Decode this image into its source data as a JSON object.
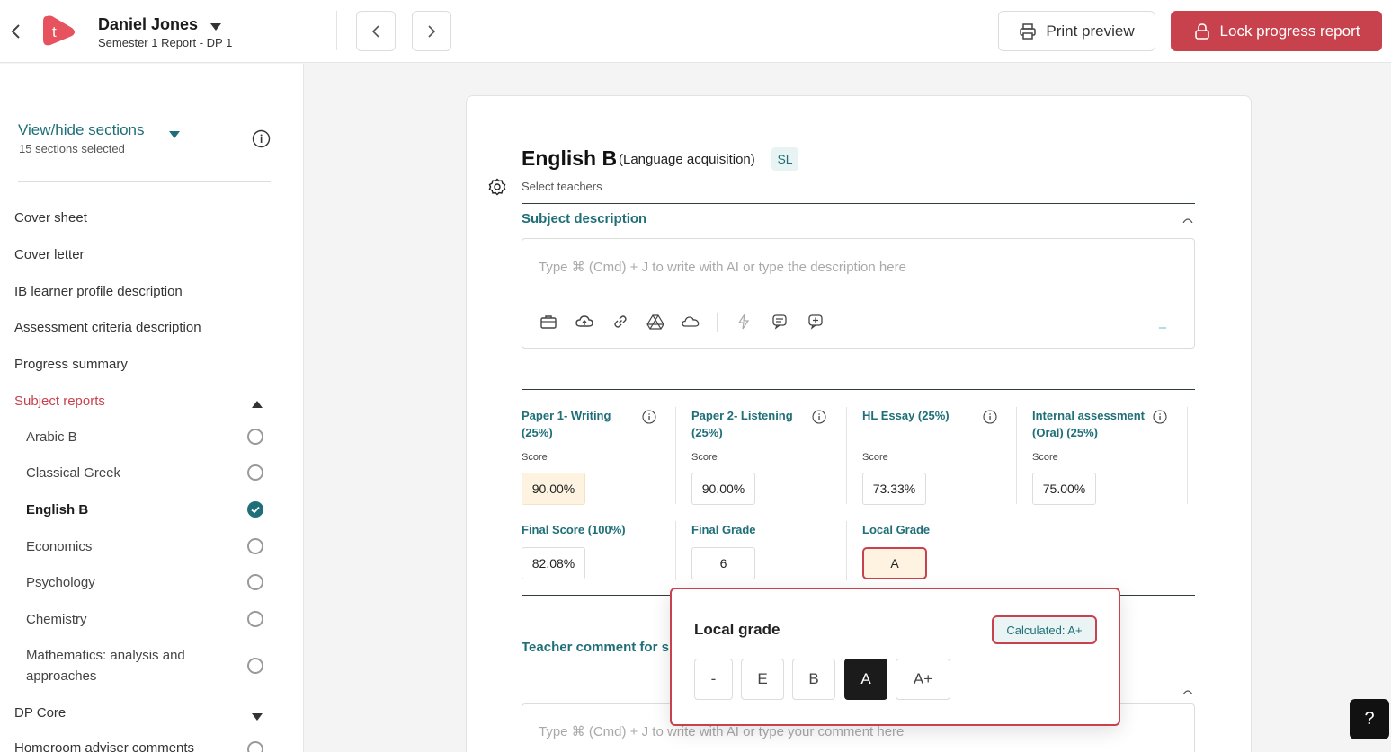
{
  "header": {
    "user_name": "Daniel Jones",
    "report_subtitle": "Semester 1 Report - DP 1",
    "logo_letter": "t",
    "print_label": "Print preview",
    "lock_label": "Lock progress report"
  },
  "sidebar": {
    "view_hide_title": "View/hide sections",
    "sections_selected": "15 sections selected",
    "items": [
      {
        "label": "Cover sheet"
      },
      {
        "label": "Cover letter"
      },
      {
        "label": "IB learner profile description"
      },
      {
        "label": "Assessment criteria description"
      },
      {
        "label": "Progress summary"
      },
      {
        "label": "Subject reports"
      }
    ],
    "subjects": [
      {
        "label": "Arabic B",
        "checked": false
      },
      {
        "label": "Classical Greek",
        "checked": false
      },
      {
        "label": "English B",
        "checked": true
      },
      {
        "label": "Economics",
        "checked": false
      },
      {
        "label": "Psychology",
        "checked": false
      },
      {
        "label": "Chemistry",
        "checked": false
      },
      {
        "label": "Mathematics: analysis and approaches",
        "checked": false
      }
    ],
    "after": [
      {
        "label": "DP Core"
      },
      {
        "label": "Homeroom adviser comments"
      }
    ]
  },
  "subject": {
    "title": "English B",
    "group": "(Language acquisition)",
    "level": "SL",
    "select_teachers": "Select teachers",
    "description_title": "Subject description",
    "description_placeholder": "Type ⌘ (Cmd) + J to write with AI or type the description here",
    "criteria": [
      {
        "label": "Paper 1- Writing (25%)",
        "score_label": "Score",
        "score": "90.00%"
      },
      {
        "label": "Paper 2- Listening (25%)",
        "score_label": "Score",
        "score": "90.00%"
      },
      {
        "label": "HL Essay (25%)",
        "score_label": "Score",
        "score": "73.33%"
      },
      {
        "label": "Internal assessment (Oral) (25%)",
        "score_label": "Score",
        "score": "75.00%"
      }
    ],
    "final_score_label": "Final Score (100%)",
    "final_score": "82.08%",
    "final_grade_label": "Final Grade",
    "final_grade": "6",
    "local_grade_label": "Local Grade",
    "local_grade": "A",
    "comment_title": "Teacher comment for s",
    "comment_placeholder": "Type ⌘ (Cmd) + J to write with AI or type your comment here"
  },
  "popover": {
    "title": "Local grade",
    "calculated": "Calculated: A+",
    "options": [
      "-",
      "E",
      "B",
      "A",
      "A+"
    ],
    "selected": "A"
  },
  "help": {
    "label": "?"
  },
  "colors": {
    "accent": "#1f6f78",
    "brand_red": "#c8424d",
    "highlight": "#fdf3e0"
  }
}
